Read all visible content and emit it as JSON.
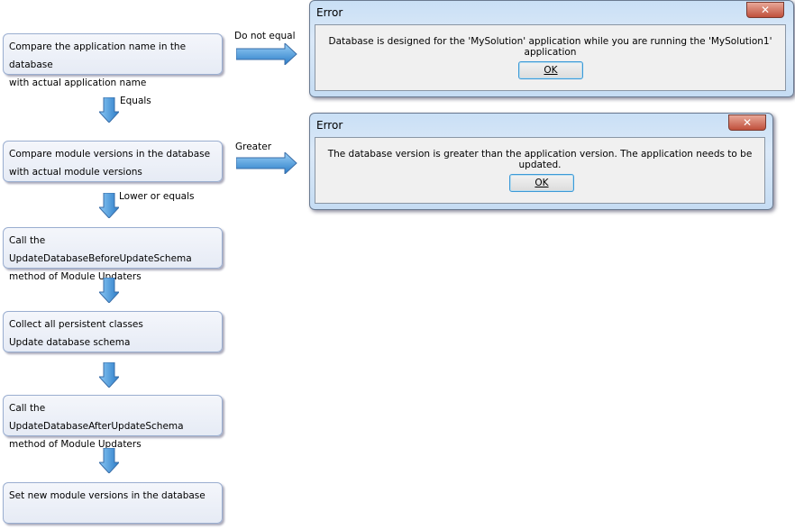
{
  "steps": [
    {
      "line1": "Compare the application name in the database",
      "line2": "with actual application name"
    },
    {
      "line1": "Compare module versions in the database",
      "line2": "with actual module versions"
    },
    {
      "line1": "Call the UpdateDatabaseBeforeUpdateSchema",
      "line2": "method of Module Updaters"
    },
    {
      "line1": "Collect all persistent classes",
      "line2": "Update database schema"
    },
    {
      "line1": "Call the UpdateDatabaseAfterUpdateSchema",
      "line2": "method of Module Updaters"
    },
    {
      "line1": "Set new module versions in the database",
      "line2": ""
    }
  ],
  "labels": {
    "equals": "Equals",
    "lower_or_equals": "Lower or equals",
    "do_not_equal": "Do not equal",
    "greater": "Greater"
  },
  "dialogs": [
    {
      "title": "Error",
      "message": "Database is designed for the 'MySolution' application while you are running the 'MySolution1' application",
      "ok": "OK",
      "close": "✕"
    },
    {
      "title": "Error",
      "message": "The database version is greater than the application version. The application needs to be updated.",
      "ok": "OK",
      "close": "✕"
    }
  ],
  "colors": {
    "arrow": "#4a9ee0",
    "box": "#e8edf6"
  }
}
